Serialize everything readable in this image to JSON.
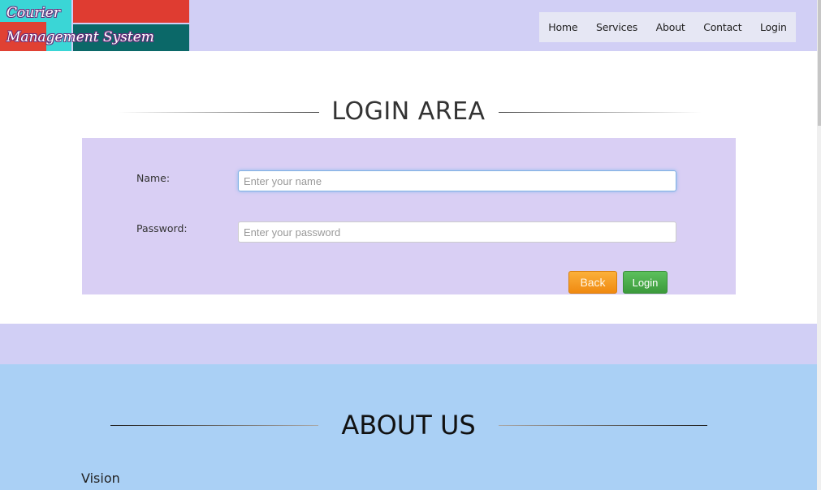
{
  "logo": {
    "line1": "Courier",
    "line2": "Management System"
  },
  "nav": {
    "items": [
      "Home",
      "Services",
      "About",
      "Contact",
      "Login"
    ]
  },
  "login": {
    "title": "LOGIN AREA",
    "name_label": "Name:",
    "name_placeholder": "Enter your name",
    "password_label": "Password:",
    "password_placeholder": "Enter your password",
    "back_label": "Back",
    "login_label": "Login"
  },
  "about": {
    "title": "ABOUT US",
    "subtitle": "Vision"
  },
  "colors": {
    "header_bg": "#d1cff5",
    "login_bg": "#d9cff4",
    "about_bg": "#aad0f5",
    "back_btn": "#f39c12",
    "login_btn": "#4cae4c"
  }
}
